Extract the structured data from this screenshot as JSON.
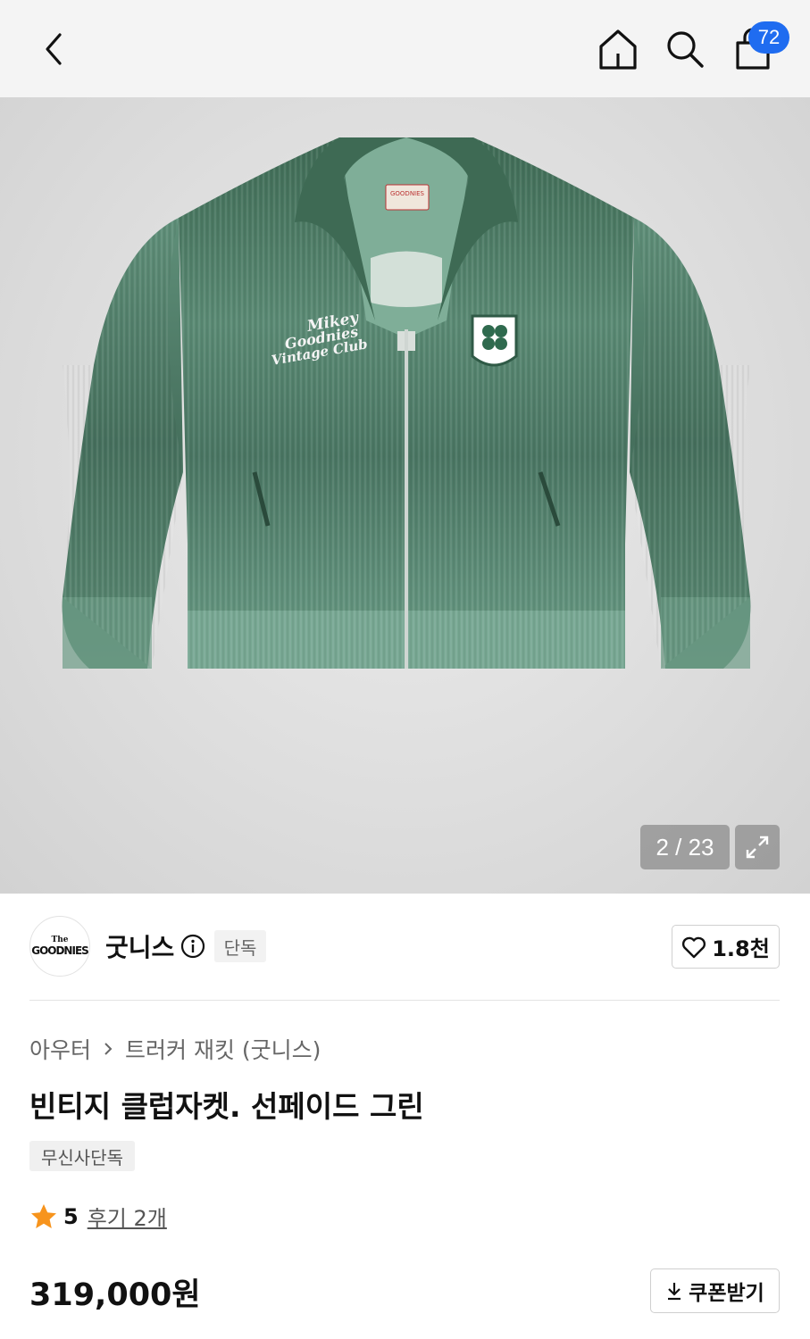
{
  "header": {
    "back_icon": "chevron-left-icon",
    "home_icon": "home-icon",
    "search_icon": "search-icon",
    "cart_icon": "shopping-bag-icon",
    "cart_count": "72",
    "badge_color": "#1f6cf0"
  },
  "gallery": {
    "counter": "2 / 23",
    "expand_icon": "expand-icon",
    "chest_embroidery": [
      "Mikey",
      "Goodnies",
      "Vintage Club"
    ],
    "collar_label": "GOODNIES"
  },
  "brand": {
    "logo_top": "The",
    "logo_word": "GOODNIES",
    "name": "굿니스",
    "info_icon": "info-icon",
    "exclusive_tag": "단독",
    "likes": "1.8천",
    "like_icon": "heart-icon"
  },
  "breadcrumb": {
    "category": "아우터",
    "subcategory": "트러커 재킷 (굿니스)"
  },
  "product": {
    "title": "빈티지 클럽자켓. 선페이드 그린",
    "store_tag": "무신사단독",
    "rating": "5",
    "star_color": "#f7941d",
    "reviews": "후기 2개",
    "price": "319,000원",
    "coupon_label": "쿠폰받기",
    "coupon_icon": "download-icon"
  }
}
